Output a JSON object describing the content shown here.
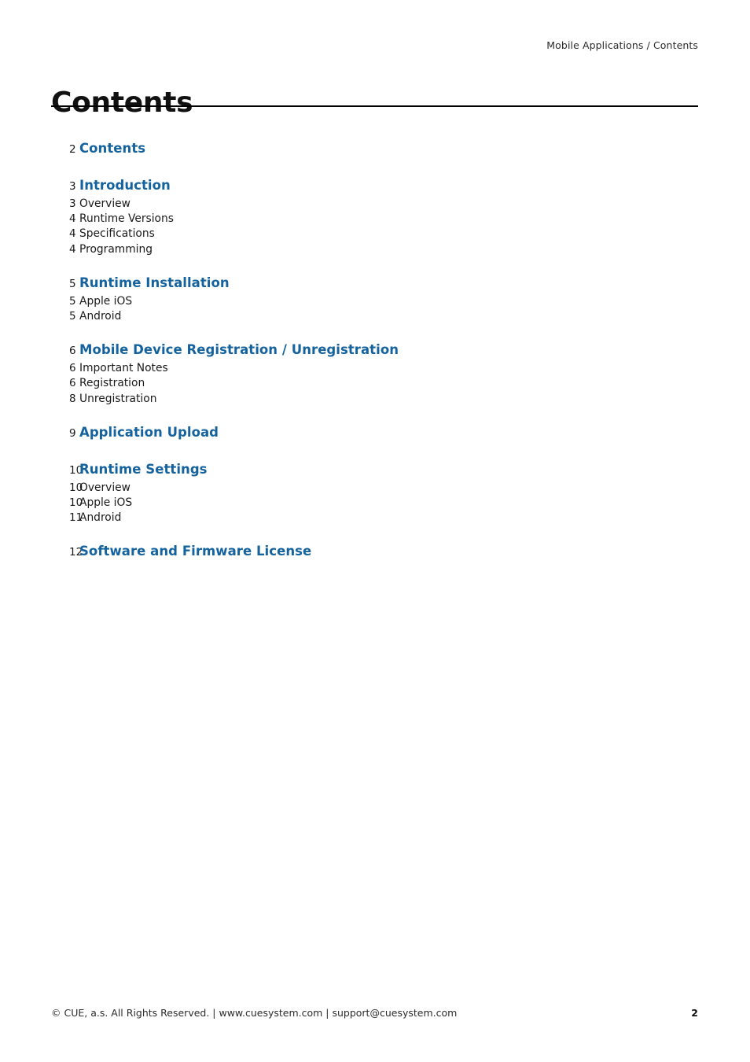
{
  "header": {
    "running_head": "Mobile Applications / Contents"
  },
  "title": {
    "text": "Contents"
  },
  "toc": {
    "groups": [
      {
        "heading": {
          "page": "2",
          "label": "Contents"
        },
        "entries": []
      },
      {
        "heading": {
          "page": "3",
          "label": "Introduction"
        },
        "entries": [
          {
            "page": "3",
            "label": "Overview"
          },
          {
            "page": "4",
            "label": "Runtime Versions"
          },
          {
            "page": "4",
            "label": "Specifications"
          },
          {
            "page": "4",
            "label": "Programming"
          }
        ]
      },
      {
        "heading": {
          "page": "5",
          "label": "Runtime Installation"
        },
        "entries": [
          {
            "page": "5",
            "label": "Apple iOS"
          },
          {
            "page": "5",
            "label": "Android"
          }
        ]
      },
      {
        "heading": {
          "page": "6",
          "label": "Mobile Device Registration / Unregistration"
        },
        "entries": [
          {
            "page": "6",
            "label": "Important Notes"
          },
          {
            "page": "6",
            "label": "Registration"
          },
          {
            "page": "8",
            "label": "Unregistration"
          }
        ]
      },
      {
        "heading": {
          "page": "9",
          "label": "Application Upload"
        },
        "entries": []
      },
      {
        "heading": {
          "page": "10",
          "label": "Runtime Settings"
        },
        "entries": [
          {
            "page": "10",
            "label": "Overview"
          },
          {
            "page": "10",
            "label": "Apple iOS"
          },
          {
            "page": "11",
            "label": "Android"
          }
        ]
      },
      {
        "heading": {
          "page": "12",
          "label": "Software and Firmware License"
        },
        "entries": []
      }
    ]
  },
  "footer": {
    "copyright": "© CUE, a.s. All Rights Reserved.  |  www.cuesystem.com  |  support@cuesystem.com",
    "page_number": "2"
  },
  "colors": {
    "heading_blue": "#15639E",
    "body_text": "#1a1a1a",
    "rule": "#000000"
  }
}
